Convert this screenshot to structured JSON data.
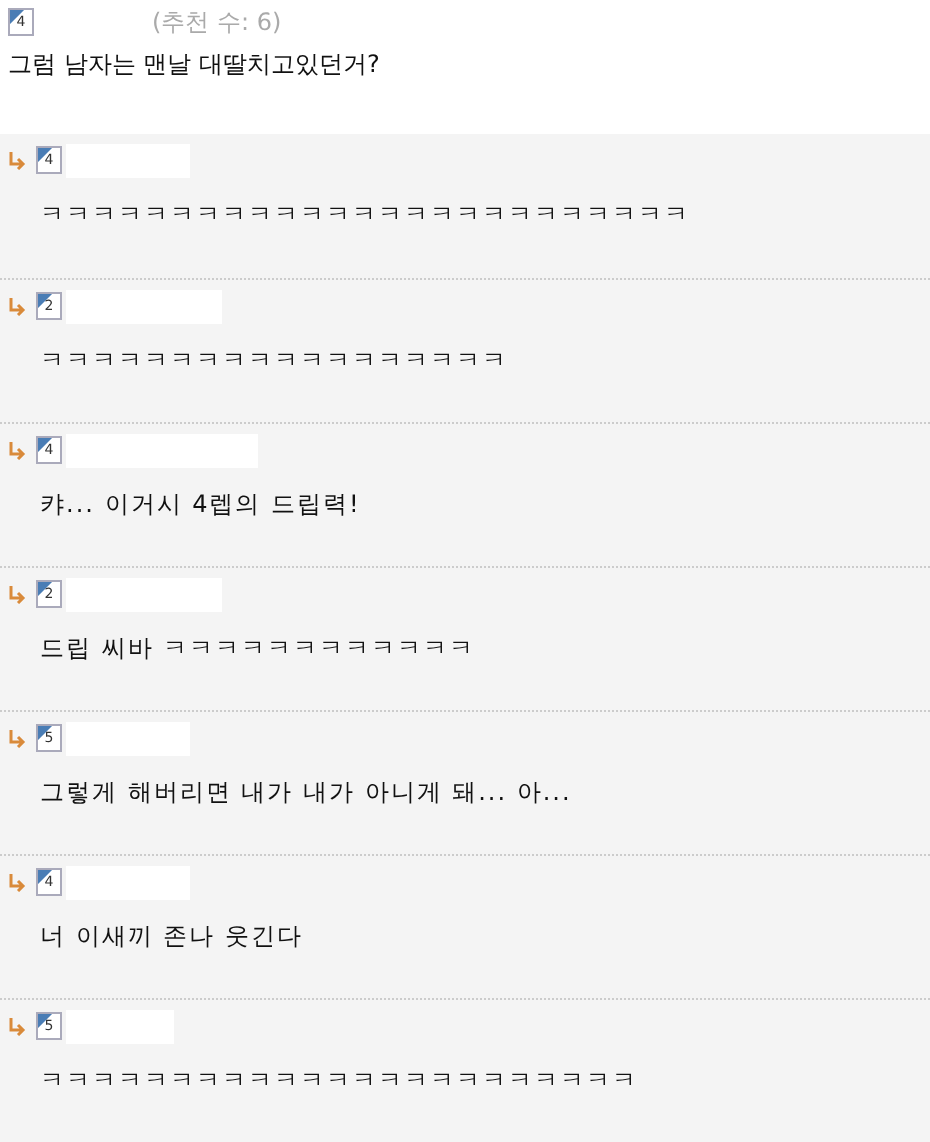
{
  "post": {
    "level": "4",
    "recommend": "(추천 수: 6)",
    "text": "그럼 남자는 맨날 대딸치고있던거?"
  },
  "comments": [
    {
      "level": "4",
      "text": "ㅋㅋㅋㅋㅋㅋㅋㅋㅋㅋㅋㅋㅋㅋㅋㅋㅋㅋㅋㅋㅋㅋㅋㅋㅋ"
    },
    {
      "level": "2",
      "text": "ㅋㅋㅋㅋㅋㅋㅋㅋㅋㅋㅋㅋㅋㅋㅋㅋㅋㅋ"
    },
    {
      "level": "4",
      "text": "캬... 이거시 4렙의 드립력!"
    },
    {
      "level": "2",
      "text": "드립 씨바 ㅋㅋㅋㅋㅋㅋㅋㅋㅋㅋㅋㅋ"
    },
    {
      "level": "5",
      "text": "그렇게 해버리면 내가 내가 아니게 돼... 아..."
    },
    {
      "level": "4",
      "text": "너 이새끼 존나 웃긴다"
    },
    {
      "level": "5",
      "text": "ㅋㅋㅋㅋㅋㅋㅋㅋㅋㅋㅋㅋㅋㅋㅋㅋㅋㅋㅋㅋㅋㅋㅋ"
    }
  ]
}
